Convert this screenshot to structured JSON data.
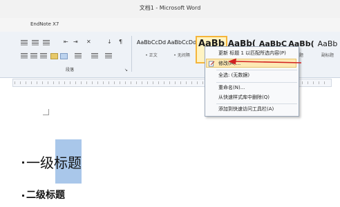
{
  "window": {
    "title": "文档1 - Microsoft Word"
  },
  "tabs": {
    "endnote": "EndNote X7"
  },
  "ribbon": {
    "paragraph_group_label": "段落",
    "styles": [
      {
        "sample": "AaBbCcDd",
        "name": "• 正文"
      },
      {
        "sample": "AaBbCcDd",
        "name": "• 无间隔"
      },
      {
        "sample": "AaBb",
        "name": ""
      },
      {
        "sample": "AaBb(",
        "name": ""
      },
      {
        "sample": "AaBbC",
        "name": ""
      },
      {
        "sample": "AaBb(",
        "name": "题"
      },
      {
        "sample": "AaBb",
        "name": "副标题"
      }
    ]
  },
  "context_menu": {
    "items": [
      {
        "label": "更新 标题 1 以匹配所选内容(P)"
      },
      {
        "label": "修改(M)..."
      },
      {
        "label": "全选: (无数据)"
      },
      {
        "label": "重命名(N)..."
      },
      {
        "label": "从快速样式库中删除(Q)"
      },
      {
        "label": "添加到快速访问工具栏(A)"
      }
    ]
  },
  "document": {
    "heading1": "一级标题",
    "heading1_selected": "标题",
    "heading2": "二级标题"
  },
  "colors": {
    "accent": "#f4b43a",
    "selection": "#a9c7ea",
    "arrow": "#d22020"
  }
}
